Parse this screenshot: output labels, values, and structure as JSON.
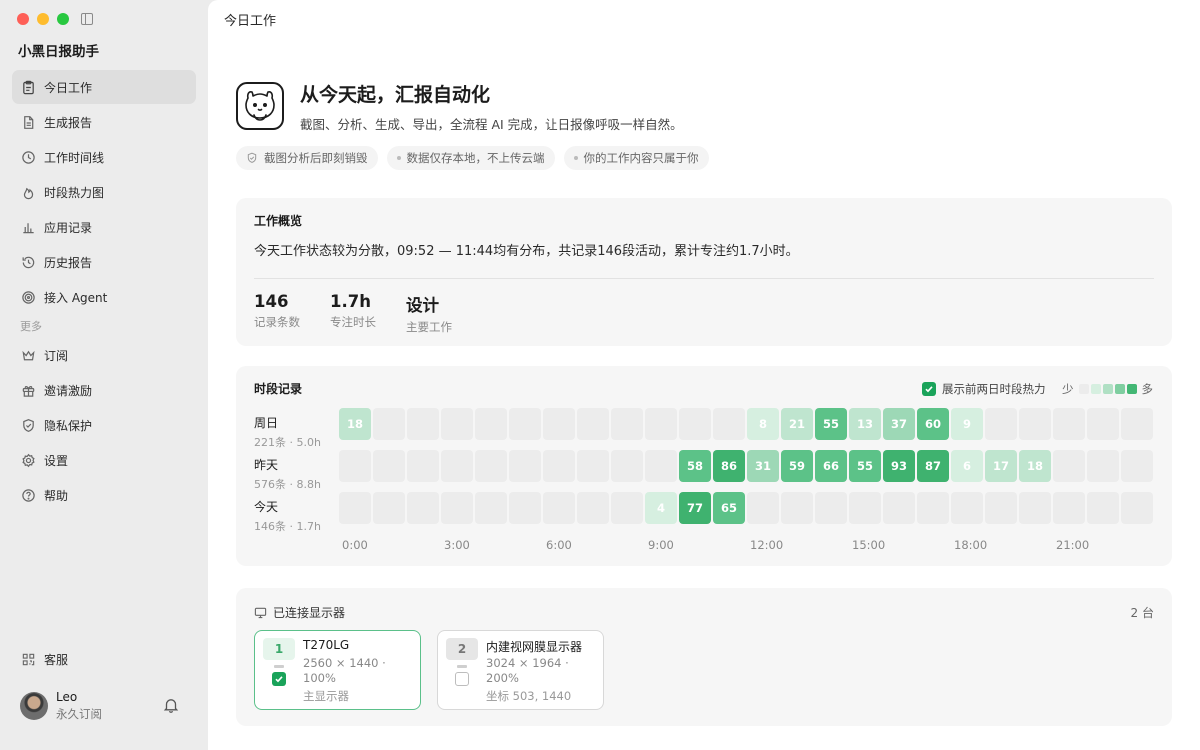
{
  "app": {
    "title": "小黑日报助手"
  },
  "sidebar": {
    "items": [
      {
        "label": "今日工作",
        "icon": "clipboard-icon",
        "active": true
      },
      {
        "label": "生成报告",
        "icon": "document-icon"
      },
      {
        "label": "工作时间线",
        "icon": "clock-icon"
      },
      {
        "label": "时段热力图",
        "icon": "flame-icon"
      },
      {
        "label": "应用记录",
        "icon": "bar-chart-icon"
      },
      {
        "label": "历史报告",
        "icon": "history-icon"
      },
      {
        "label": "接入 Agent",
        "icon": "target-icon"
      }
    ],
    "section_more": "更多",
    "more_items": [
      {
        "label": "订阅",
        "icon": "crown-icon"
      },
      {
        "label": "邀请激励",
        "icon": "gift-icon"
      },
      {
        "label": "隐私保护",
        "icon": "shield-icon"
      },
      {
        "label": "设置",
        "icon": "gear-icon"
      },
      {
        "label": "帮助",
        "icon": "help-icon"
      }
    ],
    "support": {
      "label": "客服",
      "icon": "qr-code-icon"
    },
    "user": {
      "name": "Leo",
      "plan": "永久订阅"
    }
  },
  "topbar": {
    "title": "今日工作"
  },
  "hero": {
    "title": "从今天起，汇报自动化",
    "subtitle": "截图、分析、生成、导出，全流程 AI 完成，让日报像呼吸一样自然。",
    "pills": [
      "截图分析后即刻销毁",
      "数据仅存本地，不上传云端",
      "你的工作内容只属于你"
    ]
  },
  "overview": {
    "title": "工作概览",
    "summary": "今天工作状态较为分散，09:52 — 11:44均有分布，共记录146段活动，累计专注约1.7小时。",
    "stats": [
      {
        "value": "146",
        "label": "记录条数"
      },
      {
        "value": "1.7h",
        "label": "专注时长"
      },
      {
        "value": "设计",
        "label": "主要工作"
      }
    ]
  },
  "timeline": {
    "title": "时段记录",
    "toggle_label": "展示前两日时段热力",
    "toggle_checked": true,
    "legend_low": "少",
    "legend_high": "多",
    "legend_colors": [
      "#ececec",
      "#d6efe0",
      "#b0e0c4",
      "#7fcea0",
      "#43b774"
    ],
    "axis_labels": [
      "0:00",
      "3:00",
      "6:00",
      "9:00",
      "12:00",
      "15:00",
      "18:00",
      "21:00"
    ],
    "rows": [
      {
        "name": "周日",
        "meta": "221条 · 5.0h",
        "values": [
          18,
          0,
          0,
          0,
          0,
          0,
          0,
          0,
          0,
          0,
          0,
          0,
          8,
          21,
          55,
          13,
          37,
          60,
          9,
          0,
          0,
          0,
          0,
          0
        ]
      },
      {
        "name": "昨天",
        "meta": "576条 · 8.8h",
        "values": [
          0,
          0,
          0,
          0,
          0,
          0,
          0,
          0,
          0,
          0,
          58,
          86,
          31,
          59,
          66,
          55,
          93,
          87,
          6,
          17,
          18,
          0,
          0,
          0
        ]
      },
      {
        "name": "今天",
        "meta": "146条 · 1.7h",
        "values": [
          0,
          0,
          0,
          0,
          0,
          0,
          0,
          0,
          0,
          4,
          77,
          65,
          0,
          0,
          0,
          0,
          0,
          0,
          0,
          0,
          0,
          0,
          0,
          0
        ]
      }
    ]
  },
  "displays": {
    "title": "已连接显示器",
    "count": "2 台",
    "items": [
      {
        "index": "1",
        "name": "T270LG",
        "resolution": "2560 × 1440 · 100%",
        "sub": "主显示器",
        "checked": true
      },
      {
        "index": "2",
        "name": "内建视网膜显示器",
        "resolution": "3024 × 1964 · 200%",
        "sub": "坐标 503, 1440",
        "checked": false
      }
    ]
  },
  "colors": {
    "accent_green": "#1aa35a",
    "sidebar_bg": "#ececec"
  }
}
